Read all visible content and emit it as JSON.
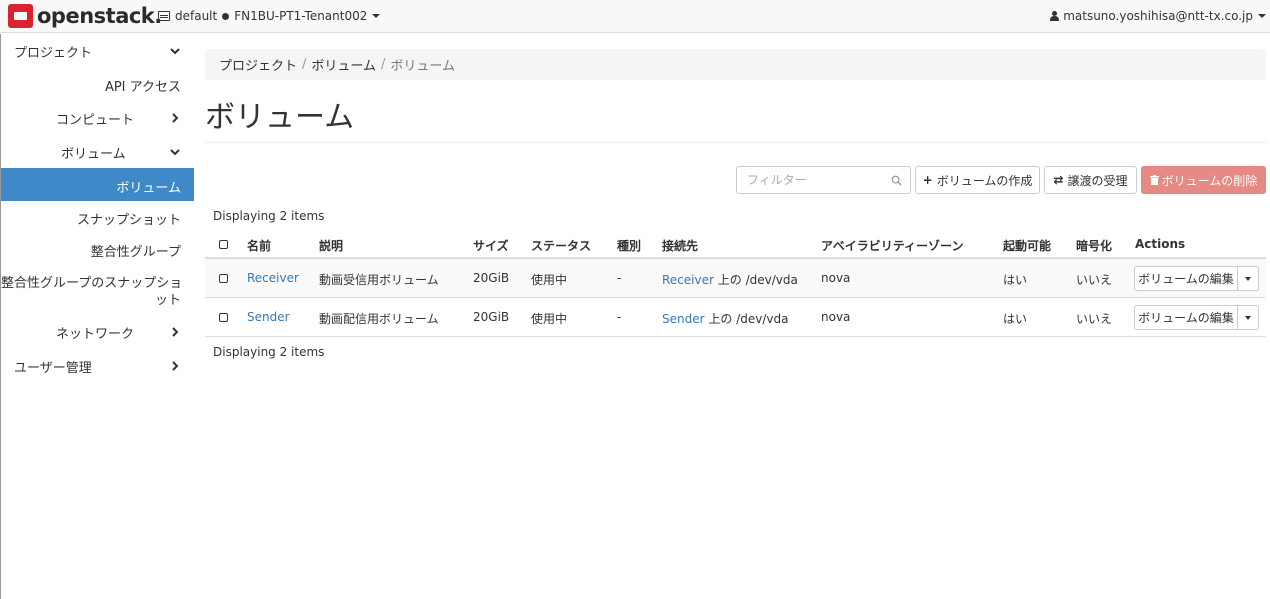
{
  "topbar": {
    "brand": "openstack.",
    "domain": "default",
    "project": "FN1BU-PT1-Tenant002",
    "user": "matsuno.yoshihisa@ntt-tx.co.jp"
  },
  "sidebar": {
    "items": [
      {
        "label": "プロジェクト"
      },
      {
        "label": "API アクセス"
      },
      {
        "label": "コンピュート"
      },
      {
        "label": "ボリューム"
      },
      {
        "label": "ボリューム"
      },
      {
        "label": "スナップショット"
      },
      {
        "label": "整合性グループ"
      },
      {
        "label": "整合性グループのスナップショ",
        "label2": "ット"
      },
      {
        "label": "ネットワーク"
      },
      {
        "label": "ユーザー管理"
      }
    ]
  },
  "breadcrumb": [
    "プロジェクト",
    "ボリューム",
    "ボリューム"
  ],
  "page_title": "ボリューム",
  "toolbar": {
    "filter_placeholder": "フィルター",
    "create_label": "ボリュームの作成",
    "accept_transfer_label": "譲渡の受理",
    "delete_label": "ボリュームの削除"
  },
  "table": {
    "count_text": "Displaying 2 items",
    "headers": [
      "名前",
      "説明",
      "サイズ",
      "ステータス",
      "種別",
      "接続先",
      "アベイラビリティーゾーン",
      "起動可能",
      "暗号化",
      "Actions"
    ],
    "rows": [
      {
        "name": "Receiver",
        "description": "動画受信用ボリューム",
        "size": "20GiB",
        "status": "使用中",
        "type": "-",
        "attached_link": "Receiver",
        "attached_suffix": "上の /dev/vda",
        "zone": "nova",
        "bootable": "はい",
        "encrypted": "いいえ",
        "action": "ボリュームの編集"
      },
      {
        "name": "Sender",
        "description": "動画配信用ボリューム",
        "size": "20GiB",
        "status": "使用中",
        "type": "-",
        "attached_link": "Sender",
        "attached_suffix": "上の /dev/vda",
        "zone": "nova",
        "bootable": "はい",
        "encrypted": "いいえ",
        "action": "ボリュームの編集"
      }
    ]
  },
  "colors": {
    "accent": "#3f89c8",
    "danger": "#e68a86",
    "link": "#337ab7"
  }
}
